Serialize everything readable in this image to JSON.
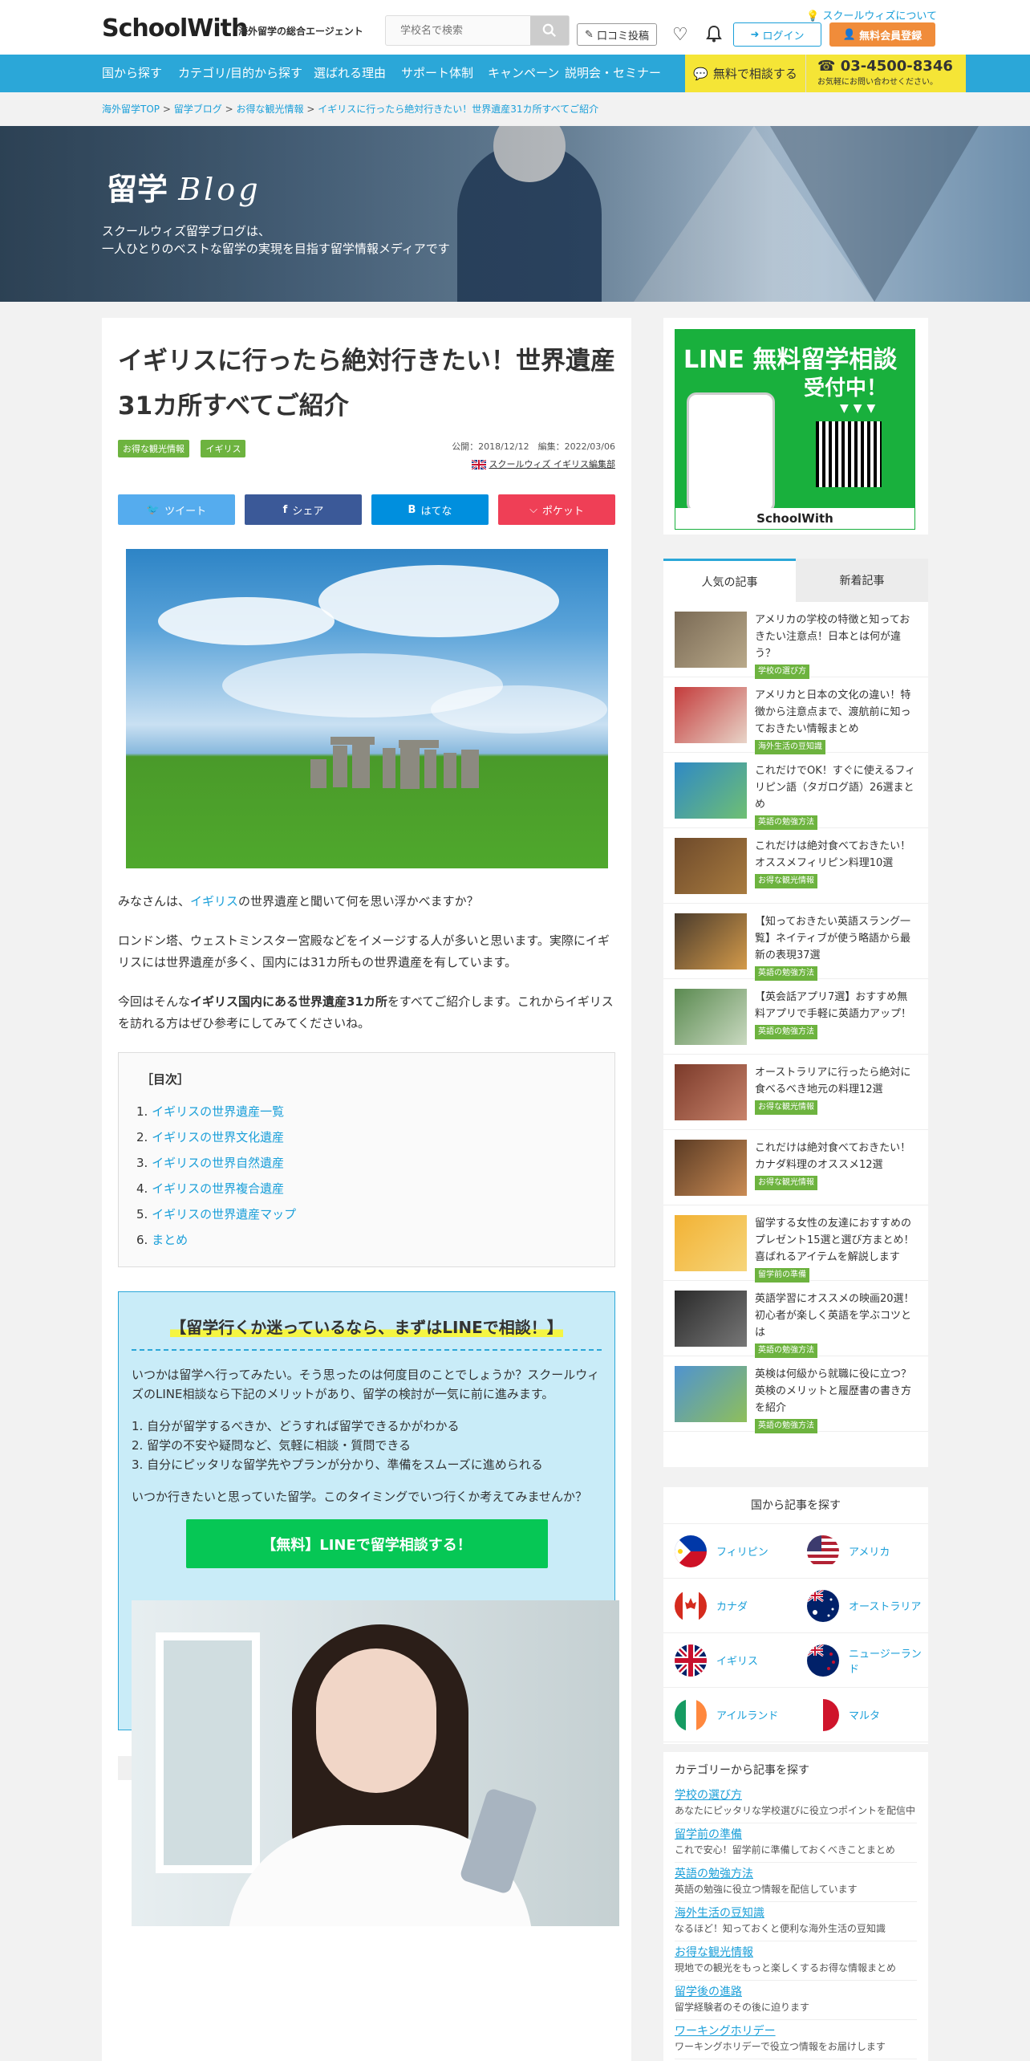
{
  "header": {
    "logo": "SchoolWith",
    "tagline": "海外留学の総合エージェント",
    "search_placeholder": "学校名で検索",
    "about_link": "スクールウィズについて",
    "review_button": "口コミ投稿",
    "login_button": "ログイン",
    "register_button": "無料会員登録"
  },
  "nav": {
    "items": [
      "国から探す",
      "カテゴリ/目的から探す",
      "選ばれる理由",
      "サポート体制",
      "キャンペーン",
      "説明会・セミナー"
    ],
    "consult": "無料で相談する",
    "tel": "03-4500-8346",
    "tel_sub": "お気軽にお問い合わせください。"
  },
  "breadcrumb": {
    "items": [
      "海外留学TOP",
      "留学ブログ",
      "お得な観光情報",
      "イギリスに行ったら絶対行きたい！世界遺産31カ所すべてご紹介"
    ],
    "separator": ">"
  },
  "hero": {
    "title": "留学",
    "title_script": "Blog",
    "desc1": "スクールウィズ留学ブログは、",
    "desc2": "一人ひとりのベストな留学の実現を目指す留学情報メディアです"
  },
  "article": {
    "title": "イギリスに行ったら絶対行きたい！世界遺産31カ所すべてご紹介",
    "tags": [
      "お得な観光情報",
      "イギリス"
    ],
    "published": "公開：2018/12/12",
    "edited": "編集：2022/03/06",
    "author": "スクールウィズ イギリス編集部",
    "share": [
      "ツイート",
      "シェア",
      "はてな",
      "ポケット"
    ],
    "p1_pre": "みなさんは、",
    "p1_link": "イギリス",
    "p1_post": "の世界遺産と聞いて何を思い浮かべますか？",
    "p2": "ロンドン塔、ウェストミンスター宮殿などをイメージする人が多いと思います。実際にイギリスには世界遺産が多く、国内には31カ所もの世界遺産を有しています。",
    "p3_pre": "今回はそんな",
    "p3_bold": "イギリス国内にある世界遺産31カ所",
    "p3_post": "をすべてご紹介します。これからイギリスを訪れる方はぜひ参考にしてみてくださいね。",
    "toc_heading": "［目次］",
    "toc": [
      "イギリスの世界遺産一覧",
      "イギリスの世界文化遺産",
      "イギリスの世界自然遺産",
      "イギリスの世界複合遺産",
      "イギリスの世界遺産マップ",
      "まとめ"
    ]
  },
  "line_box": {
    "heading": "【留学行くか迷っているなら、まずはLINEで相談！】",
    "intro": "いつかは留学へ行ってみたい。そう思ったのは何度目のことでしょうか？スクールウィズのLINE相談なら下記のメリットがあり、留学の検討が一気に前に進みます。",
    "points": [
      "1. 自分が留学するべきか、どうすれば留学できるかがわかる",
      "2. 留学の不安や疑問など、気軽に相談・質問できる",
      "3. 自分にピッタリな留学先やプランが分かり、準備をスムーズに進められる"
    ],
    "closing": "いつか行きたいと思っていた留学。このタイミングでいつ行くか考えてみませんか？",
    "button": "【無料】LINEで留学相談する！"
  },
  "sidebar": {
    "banner_title1": "LINE 無料留学相談",
    "banner_title2": "受付中！",
    "banner_arrows": "▼▼▼",
    "banner_logo": "SchoolWith",
    "tab_popular": "人気の記事",
    "tab_new": "新着記事",
    "articles": [
      {
        "title": "アメリカの学校の特徴と知っておきたい注意点！日本とは何が違う？",
        "cat": "学校の選び方",
        "c1": "#7a6a55",
        "c2": "#b9a98a"
      },
      {
        "title": "アメリカと日本の文化の違い！特徴から注意点まで、渡航前に知っておきたい情報まとめ",
        "cat": "海外生活の豆知識",
        "c1": "#c43b3b",
        "c2": "#e8d4c8"
      },
      {
        "title": "これだけでOK！すぐに使えるフィリピン語（タガログ語）26選まとめ",
        "cat": "英語の勉強方法",
        "c1": "#2f89c5",
        "c2": "#6fbf73"
      },
      {
        "title": "これだけは絶対食べておきたい！オススメフィリピン料理10選",
        "cat": "お得な観光情報",
        "c1": "#6e4a2b",
        "c2": "#a87b3f"
      },
      {
        "title": "【知っておきたい英語スラング一覧】ネイティブが使う略語から最新の表現37選",
        "cat": "英語の勉強方法",
        "c1": "#4a3b2c",
        "c2": "#d39a4a"
      },
      {
        "title": "【英会話アプリ7選】おすすめ無料アプリで手軽に英語力アップ！",
        "cat": "英語の勉強方法",
        "c1": "#5a8a50",
        "c2": "#c9d9c0"
      },
      {
        "title": "オーストラリアに行ったら絶対に食べるべき地元の料理12選",
        "cat": "お得な観光情報",
        "c1": "#7b3a2a",
        "c2": "#c8836b"
      },
      {
        "title": "これだけは絶対食べておきたい！カナダ料理のオススメ12選",
        "cat": "お得な観光情報",
        "c1": "#5b3b24",
        "c2": "#c98b54"
      },
      {
        "title": "留学する女性の友達におすすめのプレゼント15選と選び方まとめ！喜ばれるアイテムを解説します",
        "cat": "留学前の準備",
        "c1": "#f2b234",
        "c2": "#f6d57a"
      },
      {
        "title": "英語学習にオススメの映画20選！初心者が楽しく英語を学ぶコツとは",
        "cat": "英語の勉強方法",
        "c1": "#2a2a2a",
        "c2": "#777777"
      },
      {
        "title": "英検は何級から就職に役に立つ？英検のメリットと履歴書の書き方を紹介",
        "cat": "英語の勉強方法",
        "c1": "#4f93d0",
        "c2": "#8fbf5a"
      }
    ],
    "countries_heading": "国から記事を探す",
    "countries": [
      "フィリピン",
      "アメリカ",
      "カナダ",
      "オーストラリア",
      "イギリス",
      "ニュージーランド",
      "アイルランド",
      "マルタ"
    ],
    "categories_heading": "カテゴリーから記事を探す",
    "categories": [
      {
        "name": "学校の選び方",
        "desc": "あなたにピッタリな学校選びに役立つポイントを配信中"
      },
      {
        "name": "留学前の準備",
        "desc": "これで安心！留学前に準備しておくべきことまとめ"
      },
      {
        "name": "英語の勉強方法",
        "desc": "英語の勉強に役立つ情報を配信しています"
      },
      {
        "name": "海外生活の豆知識",
        "desc": "なるほど！知っておくと便利な海外生活の豆知識"
      },
      {
        "name": "お得な観光情報",
        "desc": "現地での観光をもっと楽しくするお得な情報まとめ"
      },
      {
        "name": "留学後の進路",
        "desc": "留学経験者のその後に迫ります"
      },
      {
        "name": "ワーキングホリデー",
        "desc": "ワーキングホリデーで役立つ情報をお届けします"
      }
    ]
  },
  "colors": {
    "brand_blue": "#2ba7d8",
    "accent_orange": "#f08c3a",
    "tag_green": "#6db33f",
    "line_green": "#06c755",
    "twitter": "#55acee",
    "facebook": "#3b5998",
    "hatena": "#008fde",
    "pocket": "#ef3f56"
  }
}
